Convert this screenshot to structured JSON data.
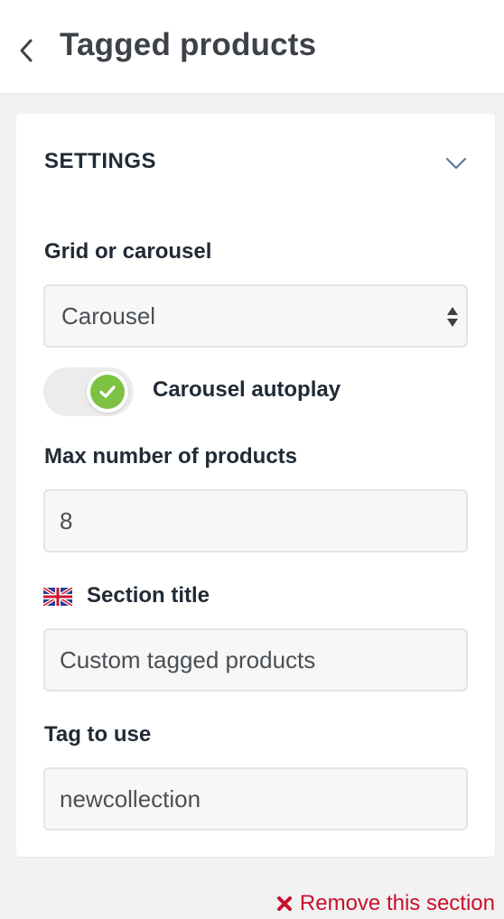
{
  "header": {
    "title": "Tagged products",
    "back_icon": "chevron-left-icon"
  },
  "settings": {
    "title": "SETTINGS",
    "collapse_icon": "chevron-down-icon",
    "layout_label": "Grid or carousel",
    "layout_value": "Carousel",
    "autoplay_label": "Carousel autoplay",
    "autoplay_on": true,
    "max_products_label": "Max number of products",
    "max_products_value": "8",
    "section_title_label": "Section title",
    "section_title_language_icon": "uk-flag-icon",
    "section_title_value": "Custom tagged products",
    "tag_label": "Tag to use",
    "tag_value": "newcollection"
  },
  "footer": {
    "remove_label": "Remove this section",
    "remove_icon": "close-icon"
  },
  "colors": {
    "toggle_on": "#7dc242",
    "danger": "#c8102e",
    "field_bg": "#f7f7f7",
    "page_bg": "#f2f2f2"
  }
}
